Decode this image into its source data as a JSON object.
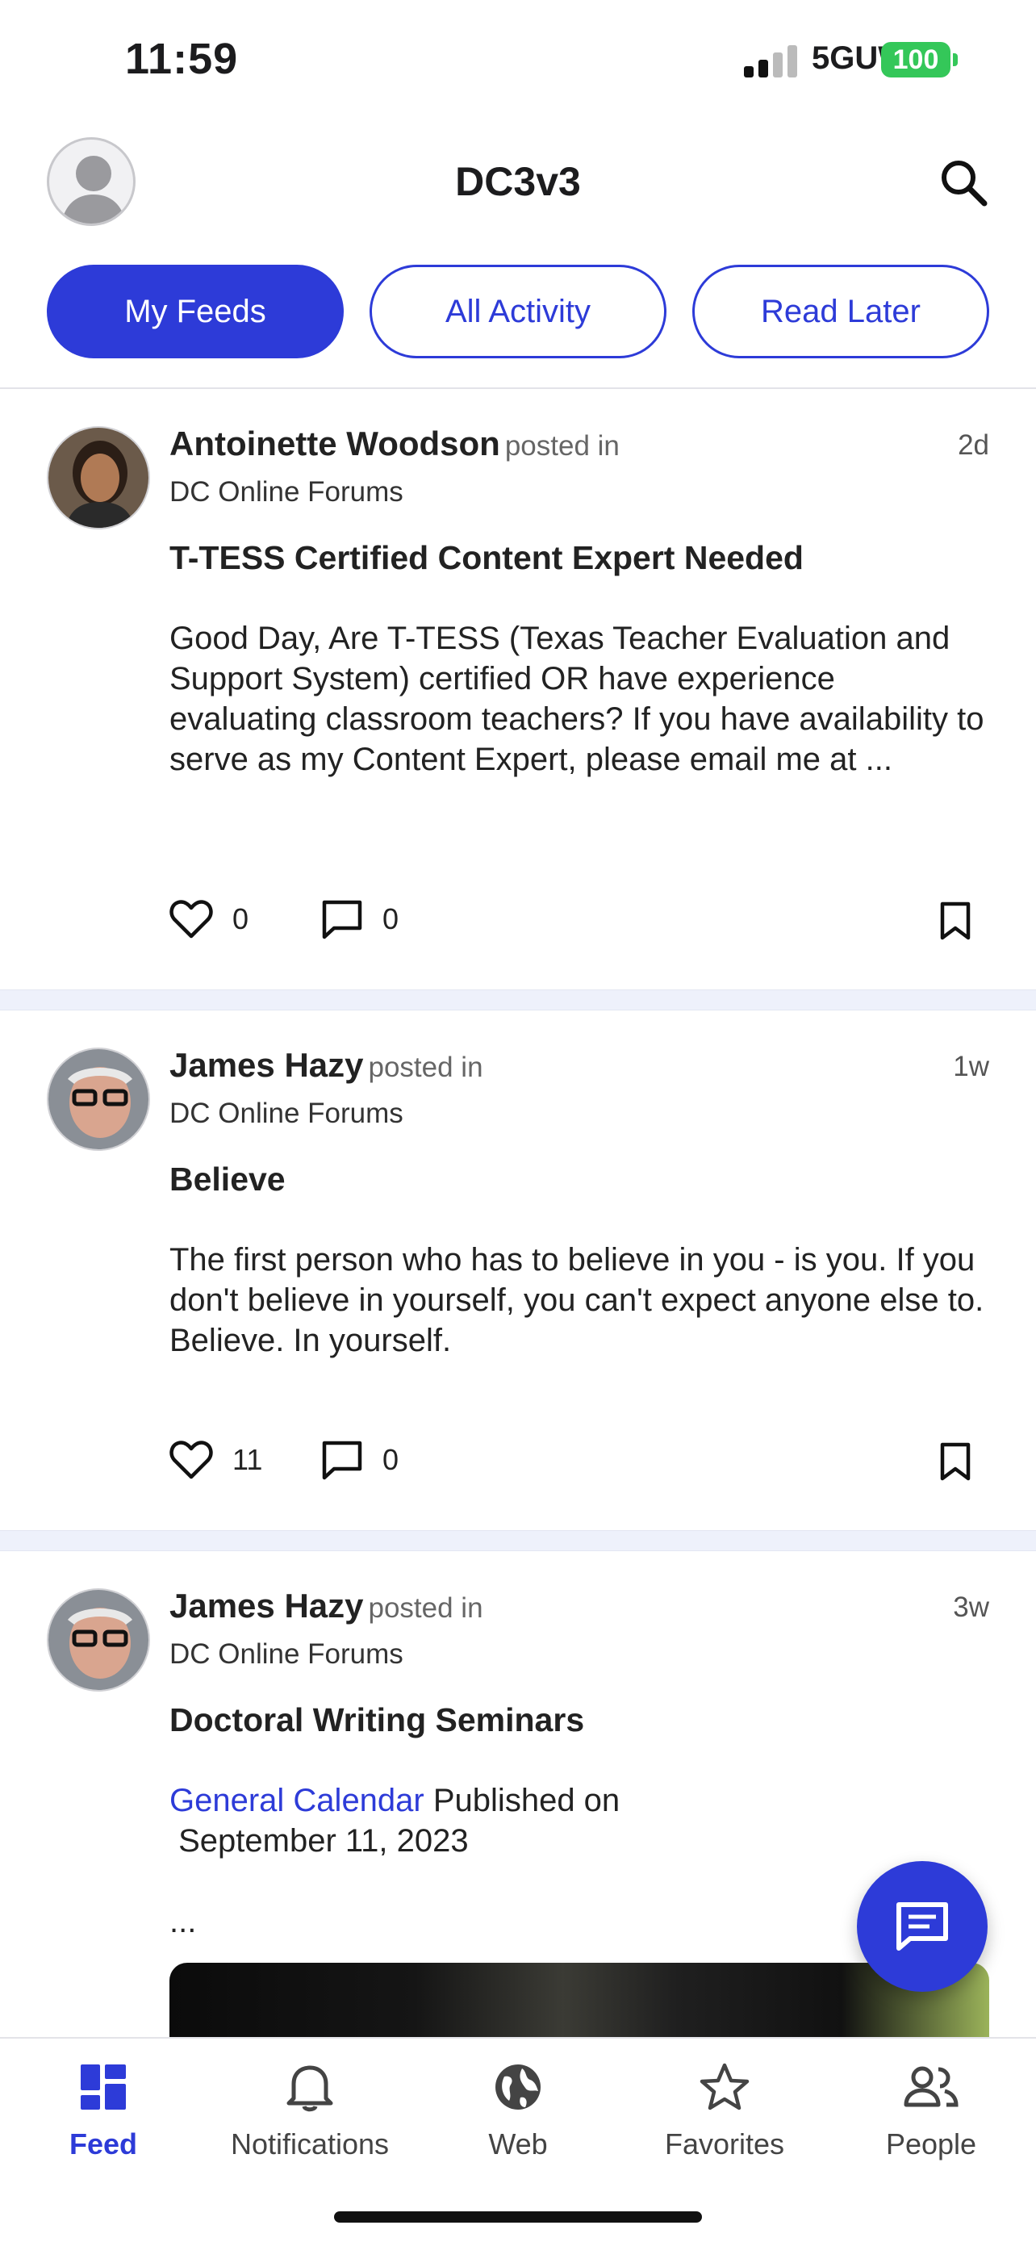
{
  "status_bar": {
    "time": "11:59",
    "network": "5GUW",
    "battery": "100"
  },
  "header": {
    "title": "DC3v3"
  },
  "tabs": [
    {
      "label": "My Feeds",
      "active": true
    },
    {
      "label": "All Activity",
      "active": false
    },
    {
      "label": "Read Later",
      "active": false
    }
  ],
  "posts": [
    {
      "author": "Antoinette Woodson",
      "posted_in": "posted in",
      "forum": "DC Online Forums",
      "time": "2d",
      "title": "T-TESS Certified Content Expert Needed",
      "body": "Good Day, Are T-TESS (Texas Teacher Evaluation and Support System) certified OR have experience evaluating classroom teachers? If you have availability to serve as my Content Expert, please email me at ...",
      "likes": "0",
      "comments": "0"
    },
    {
      "author": "James Hazy",
      "posted_in": "posted in",
      "forum": "DC Online Forums",
      "time": "1w",
      "title": "Believe",
      "body": "The first person who has to believe in you - is you. If you don't believe in yourself, you can't expect anyone else to. Believe. In yourself.",
      "likes": "11",
      "comments": "0"
    },
    {
      "author": "James Hazy",
      "posted_in": "posted in",
      "forum": "DC Online Forums",
      "time": "3w",
      "title": "Doctoral Writing Seminars",
      "link": "General Calendar",
      "published": "Published on",
      "date": "September 11, 2023",
      "ellipsis": "..."
    }
  ],
  "bottom_nav": [
    {
      "label": "Feed",
      "icon": "grid-icon",
      "active": true
    },
    {
      "label": "Notifications",
      "icon": "bell-icon",
      "active": false
    },
    {
      "label": "Web",
      "icon": "globe-icon",
      "active": false
    },
    {
      "label": "Favorites",
      "icon": "star-icon",
      "active": false
    },
    {
      "label": "People",
      "icon": "people-icon",
      "active": false
    }
  ],
  "colors": {
    "accent": "#2d3bd8",
    "battery": "#34c759",
    "separator": "#eef1fb"
  }
}
